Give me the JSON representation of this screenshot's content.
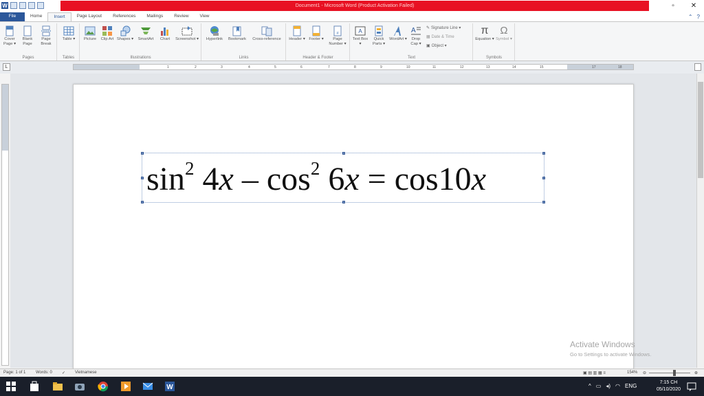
{
  "window": {
    "title": "Document1 - Microsoft Word (Product Activation Failed)"
  },
  "tabs": [
    "File",
    "Home",
    "Insert",
    "Page Layout",
    "References",
    "Mailings",
    "Review",
    "View"
  ],
  "active_tab": "Insert",
  "ribbon": {
    "pages": {
      "label": "Pages",
      "cover": "Cover Page ▾",
      "blank": "Blank Page",
      "break": "Page Break"
    },
    "tables": {
      "label": "Tables",
      "table": "Table ▾"
    },
    "illustrations": {
      "label": "Illustrations",
      "picture": "Picture",
      "clipart": "Clip Art",
      "shapes": "Shapes ▾",
      "smartart": "SmartArt",
      "chart": "Chart",
      "screenshot": "Screenshot ▾"
    },
    "links": {
      "label": "Links",
      "hyperlink": "Hyperlink",
      "bookmark": "Bookmark",
      "crossref": "Cross-reference"
    },
    "headerfooter": {
      "label": "Header & Footer",
      "header": "Header ▾",
      "footer": "Footer ▾",
      "pagenumber": "Page Number ▾"
    },
    "text": {
      "label": "Text",
      "textbox": "Text Box ▾",
      "quickparts": "Quick Parts ▾",
      "wordart": "WordArt ▾",
      "dropcap": "Drop Cap ▾",
      "signature": "Signature Line ▾",
      "datetime": "Date & Time",
      "object": "Object ▾"
    },
    "symbols": {
      "label": "Symbols",
      "equation": "Equation ▾",
      "symbol": "Symbol ▾"
    }
  },
  "equation": {
    "sin": "sin",
    "e1": "2",
    "t1": " 4",
    "v1": "x",
    "minus": " – cos",
    "e2": "2",
    "t2": " 6",
    "v2": "x",
    "eqsign": " = cos10",
    "v3": "x"
  },
  "activate": {
    "title": "Activate Windows",
    "subtitle": "Go to Settings to activate Windows."
  },
  "status": {
    "page": "Page: 1 of 1",
    "words": "Words: 0",
    "language": "Vietnamese",
    "zoom": "154%"
  },
  "tray": {
    "lang": "ENG",
    "time": "7:15 CH",
    "date": "05/10/2020"
  },
  "colors": {
    "accent": "#2b579a",
    "titlebar_warning": "#e81123",
    "taskbar": "#1a1f2a"
  }
}
